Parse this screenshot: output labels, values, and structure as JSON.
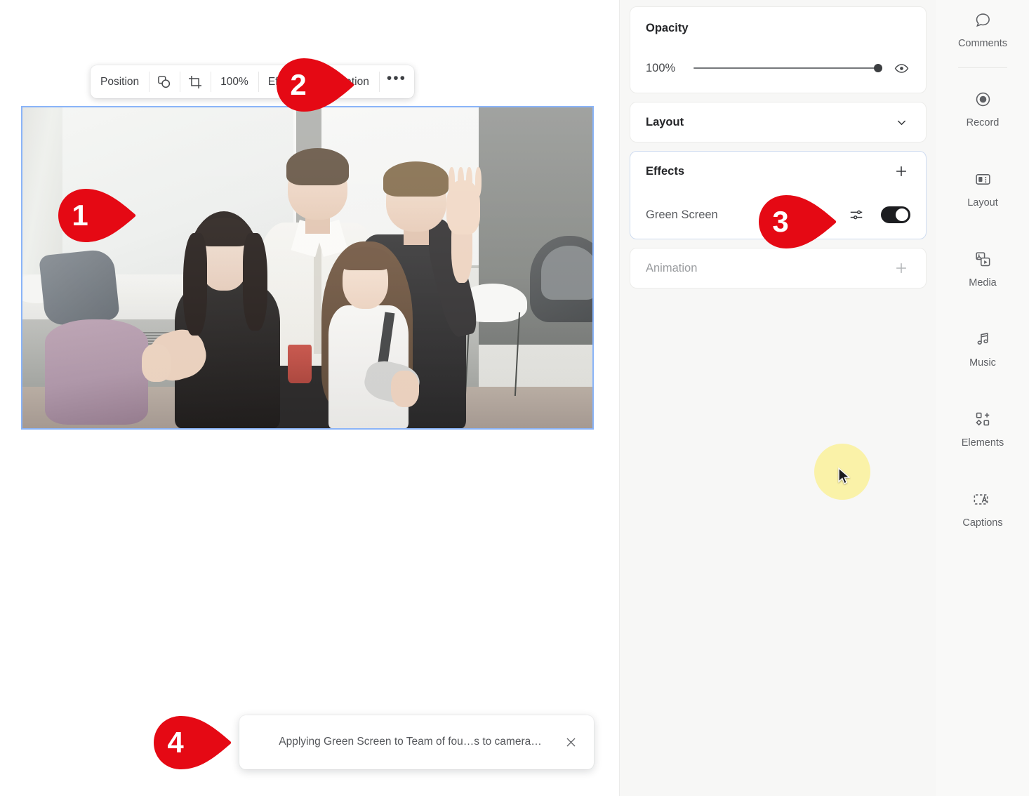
{
  "element_toolbar": {
    "position_label": "Position",
    "shapes_icon": "overlap-shapes-icon",
    "crop_icon": "crop-icon",
    "zoom_value": "100%",
    "effects_label": "Effects",
    "animation_label": "Animation",
    "more_label": "•••"
  },
  "canvas": {
    "selected_clip_name": "Team of four says to camera"
  },
  "toast": {
    "message": "Applying Green Screen to Team of fou…s to camera…",
    "close_icon": "close-icon"
  },
  "markers": [
    {
      "number": "1",
      "target": "video-clip"
    },
    {
      "number": "2",
      "target": "effects-toolbar-button"
    },
    {
      "number": "3",
      "target": "green-screen-effect-row"
    },
    {
      "number": "4",
      "target": "applying-effect-toast"
    }
  ],
  "properties_panel": {
    "opacity": {
      "title": "Opacity",
      "value": "100%",
      "percent": 100,
      "visibility_icon": "eye-icon"
    },
    "layout": {
      "title": "Layout",
      "expand_icon": "chevron-down-icon"
    },
    "effects": {
      "title": "Effects",
      "add_icon": "plus-icon",
      "items": [
        {
          "name": "Green Screen",
          "settings_icon": "sliders-icon",
          "enabled": true
        }
      ]
    },
    "animation": {
      "title": "Animation",
      "add_icon": "plus-icon"
    }
  },
  "rail": {
    "items": [
      {
        "label": "Comments",
        "icon": "comment-bubble-icon"
      },
      {
        "label": "Record",
        "icon": "record-circle-icon"
      },
      {
        "label": "Layout",
        "icon": "layout-panels-icon"
      },
      {
        "label": "Media",
        "icon": "media-stack-icon"
      },
      {
        "label": "Music",
        "icon": "music-notes-icon"
      },
      {
        "label": "Elements",
        "icon": "elements-shapes-icon"
      },
      {
        "label": "Captions",
        "icon": "captions-a-icon"
      }
    ]
  },
  "colors": {
    "marker_red": "#e50914",
    "selection_blue": "#8ab4f8",
    "cursor_highlight": "#faf2a8",
    "panel_bg": "#f7f7f6",
    "rail_bg": "#f9f9f8"
  }
}
